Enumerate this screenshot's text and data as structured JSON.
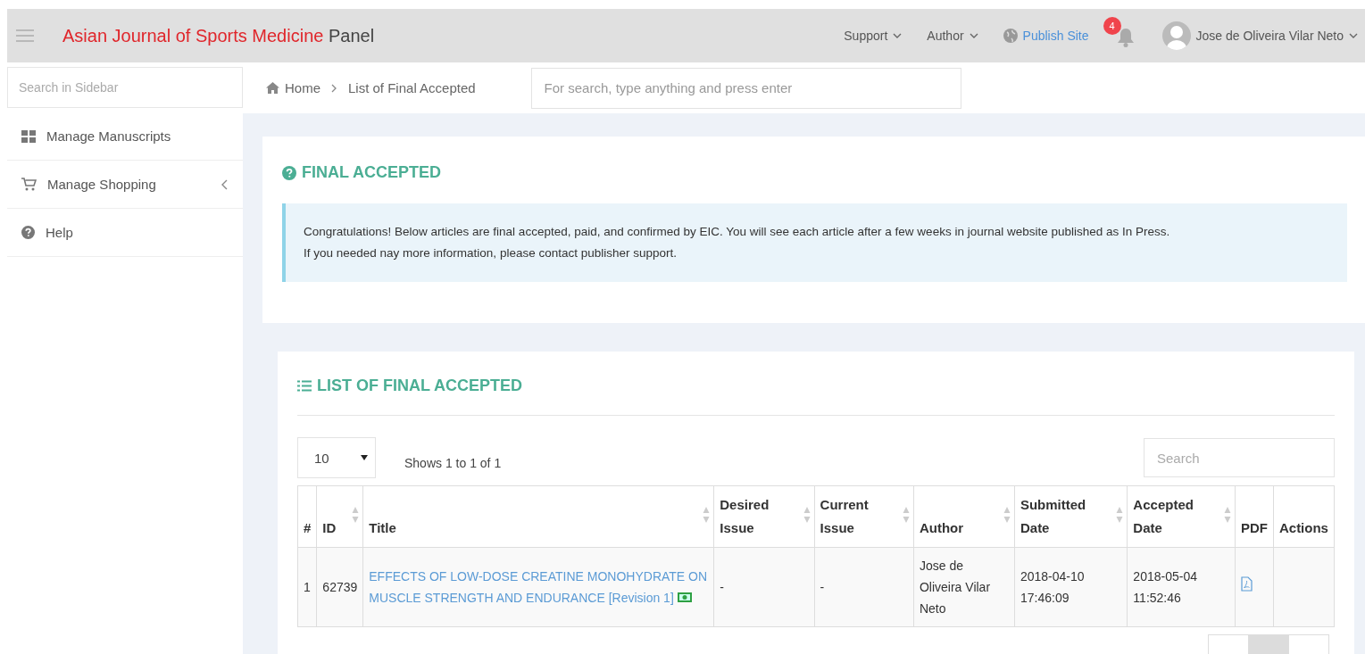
{
  "header": {
    "title": "Asian Journal of Sports Medicine",
    "title_suffix": "Panel",
    "menus": [
      {
        "label": "Support",
        "kind": "dropdown"
      },
      {
        "label": "Author",
        "kind": "dropdown"
      },
      {
        "label": "Publish Site",
        "kind": "link"
      }
    ],
    "notifications": "4",
    "user": "Jose de Oliveira Vilar Neto"
  },
  "sidebar": {
    "search": {
      "placeholder": "Search in Sidebar"
    },
    "items": [
      {
        "label": "Manage Manuscripts",
        "kind": "link"
      },
      {
        "label": "Manage Shopping",
        "kind": "menu",
        "expanded": false
      },
      {
        "label": "Help",
        "kind": "link"
      }
    ]
  },
  "breadcrumb": [
    "Home",
    "List of Final Accepted"
  ],
  "global_search": {
    "placeholder": "For search, type anything and press enter"
  },
  "intro": {
    "title": "FINAL ACCEPTED",
    "notice": [
      "Congratulations! Below articles are final accepted, paid, and confirmed by EIC. You will see each article after a few weeks in journal website published as In Press.",
      "If you needed nay more information, please contact publisher support."
    ]
  },
  "list": {
    "title": "LIST OF FINAL ACCEPTED",
    "page_size": "10",
    "info": "Shows 1 to 1 of 1",
    "search": {
      "placeholder": "Search"
    },
    "columns": [
      {
        "label": "#",
        "sortable": false
      },
      {
        "label": "ID",
        "sortable": true
      },
      {
        "label": "Title",
        "sortable": true
      },
      {
        "label": "Desired Issue",
        "sortable": true
      },
      {
        "label": "Current Issue",
        "sortable": true
      },
      {
        "label": "Author",
        "sortable": true
      },
      {
        "label": "Submitted Date",
        "sortable": true
      },
      {
        "label": "Accepted Date",
        "sortable": true
      },
      {
        "label": "PDF",
        "sortable": false
      },
      {
        "label": "Actions",
        "sortable": false
      }
    ],
    "rows": [
      {
        "index": "1",
        "id": "62739",
        "title": "EFFECTS OF LOW-DOSE CREATINE MONOHYDRATE ON MUSCLE STRENGTH AND ENDURANCE [Revision 1]",
        "desired_issue": "-",
        "current_issue": "-",
        "author": "Jose de Oliveira Vilar Neto",
        "submitted": [
          "2018-04-10",
          "17:46:09"
        ],
        "accepted": [
          "2018-05-04",
          "11:52:46"
        ]
      }
    ],
    "pages": [
      {
        "selected": false
      },
      {
        "selected": true
      },
      {
        "selected": false
      }
    ]
  }
}
